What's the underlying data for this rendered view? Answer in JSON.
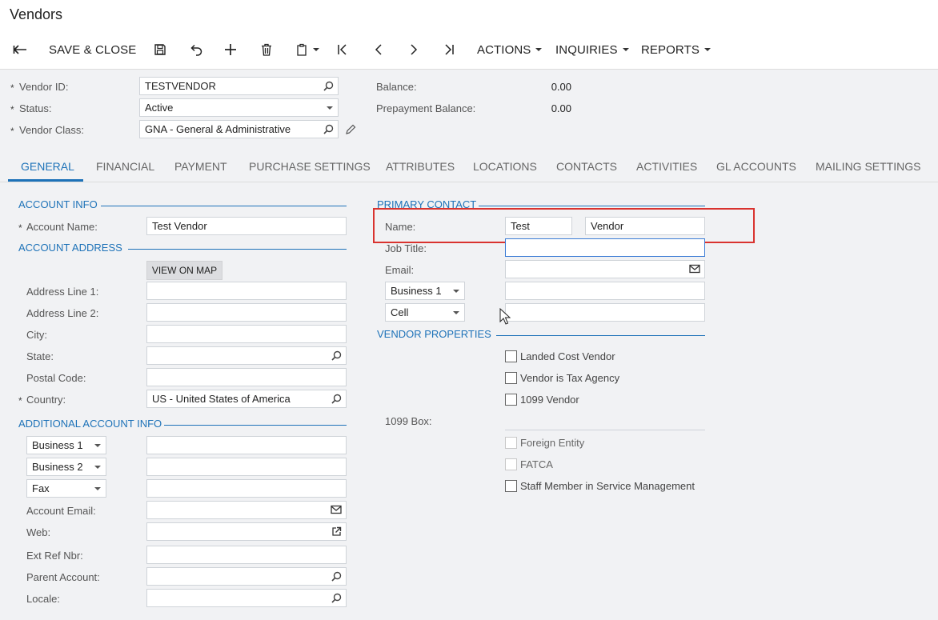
{
  "page": {
    "title": "Vendors"
  },
  "toolbar": {
    "save_close": "SAVE & CLOSE",
    "actions": "ACTIONS",
    "inquiries": "INQUIRIES",
    "reports": "REPORTS"
  },
  "header": {
    "vendor_id": {
      "label": "Vendor ID:",
      "value": "TESTVENDOR"
    },
    "status": {
      "label": "Status:",
      "value": "Active"
    },
    "vendor_class": {
      "label": "Vendor Class:",
      "value": "GNA - General & Administrative"
    },
    "balance": {
      "label": "Balance:",
      "value": "0.00"
    },
    "prepayment_balance": {
      "label": "Prepayment Balance:",
      "value": "0.00"
    },
    "required_mark": "*"
  },
  "tabs": [
    "GENERAL",
    "FINANCIAL",
    "PAYMENT",
    "PURCHASE SETTINGS",
    "ATTRIBUTES",
    "LOCATIONS",
    "CONTACTS",
    "ACTIVITIES",
    "GL ACCOUNTS",
    "MAILING SETTINGS"
  ],
  "account_info": {
    "section": "ACCOUNT INFO",
    "account_name": {
      "label": "Account Name:",
      "value": "Test Vendor"
    }
  },
  "account_address": {
    "section": "ACCOUNT ADDRESS",
    "view_on_map": "VIEW ON MAP",
    "address_line_1": {
      "label": "Address Line 1:",
      "value": ""
    },
    "address_line_2": {
      "label": "Address Line 2:",
      "value": ""
    },
    "city": {
      "label": "City:",
      "value": ""
    },
    "state": {
      "label": "State:",
      "value": ""
    },
    "postal_code": {
      "label": "Postal Code:",
      "value": ""
    },
    "country": {
      "label": "Country:",
      "value": "US - United States of America"
    }
  },
  "additional_info": {
    "section": "ADDITIONAL ACCOUNT INFO",
    "phone1_type": "Business 1",
    "phone2_type": "Business 2",
    "fax_type": "Fax",
    "account_email": {
      "label": "Account Email:",
      "value": ""
    },
    "web": {
      "label": "Web:",
      "value": ""
    },
    "ext_ref_nbr": {
      "label": "Ext Ref Nbr:",
      "value": ""
    },
    "parent_account": {
      "label": "Parent Account:",
      "value": ""
    },
    "locale": {
      "label": "Locale:",
      "value": ""
    }
  },
  "primary_contact": {
    "section": "PRIMARY CONTACT",
    "name": {
      "label": "Name:",
      "first": "Test",
      "last": "Vendor"
    },
    "job_title": {
      "label": "Job Title:",
      "value": ""
    },
    "email": {
      "label": "Email:",
      "value": ""
    },
    "phone1_type": "Business 1",
    "phone2_type": "Cell"
  },
  "vendor_properties": {
    "section": "VENDOR PROPERTIES",
    "landed_cost": "Landed Cost Vendor",
    "tax_agency": "Vendor is Tax Agency",
    "vendor_1099": "1099 Vendor",
    "box_1099_label": "1099 Box:",
    "foreign_entity": "Foreign Entity",
    "fatca": "FATCA",
    "staff_member": "Staff Member in Service Management"
  },
  "colors": {
    "accent": "#1d72b8",
    "highlight": "#d9332f",
    "panel": "#f1f2f4"
  }
}
